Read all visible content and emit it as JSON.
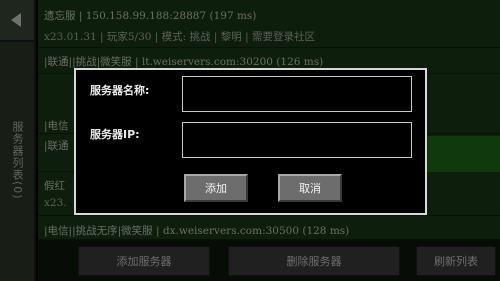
{
  "sidebar": {
    "tab_label": "服务器列表(0)"
  },
  "servers": [
    {
      "line1": "遗忘服 | 150.158.99.188:28887 (197 ms)",
      "line2": "x23.01.31 | 玩家5/30 | 模式: 挑战 | 黎明 | 需要登录社区"
    },
    {
      "line1": "|联通||挑战|微笑服 | lt.weiservers.com:30200 (126 ms)",
      "line2": ""
    },
    {
      "line1": "|电信",
      "line2": ""
    },
    {
      "line1": "|联通",
      "line2": ""
    },
    {
      "line1": "假红",
      "line2": "x23.",
      "selected": true
    },
    {
      "line1": "|电信||挑战无序|微笑服 | dx.weiservers.com:30500 (128 ms)",
      "line2": ""
    }
  ],
  "bottom_bar": {
    "add_server": "添加服务器",
    "delete_server": "删除服务器",
    "refresh_list": "刷新列表"
  },
  "dialog": {
    "name_label": "服务器名称:",
    "name_value": "",
    "ip_label": "服务器IP:",
    "ip_value": "",
    "add_button": "添加",
    "cancel_button": "取消"
  }
}
